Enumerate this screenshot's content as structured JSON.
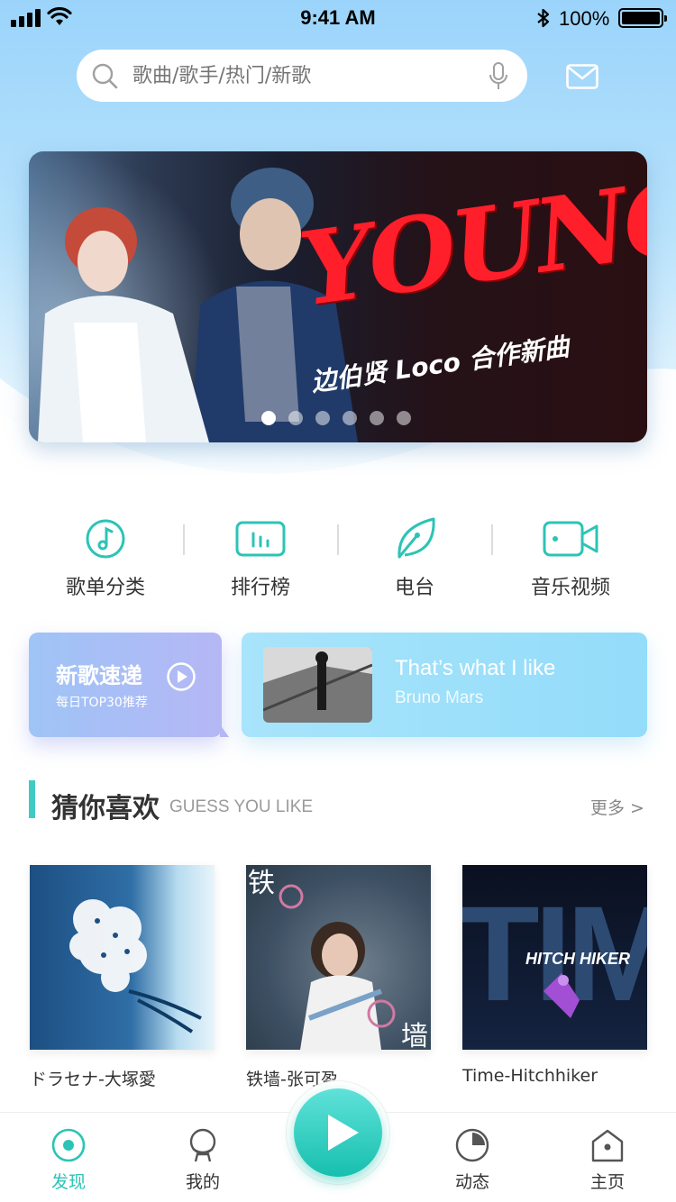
{
  "status_bar": {
    "time": "9:41 AM",
    "battery": "100%"
  },
  "search": {
    "placeholder": "歌曲/歌手/热门/新歌",
    "value": ""
  },
  "banner": {
    "title": "YOUNG",
    "subtitle": "边伯贤 Loco 合作新曲",
    "slide_count": 6,
    "active_slide": 1
  },
  "categories": [
    {
      "label": "歌单分类",
      "icon": "music-note-icon"
    },
    {
      "label": "排行榜",
      "icon": "chart-bars-icon"
    },
    {
      "label": "电台",
      "icon": "leaf-radio-icon"
    },
    {
      "label": "音乐视频",
      "icon": "video-camera-icon"
    }
  ],
  "new_songs": {
    "title": "新歌速递",
    "subtitle": "每日TOP30推荐"
  },
  "now_song": {
    "title": "That’s what I like",
    "artist": "Bruno Mars"
  },
  "section": {
    "title": "猜你喜欢",
    "subtitle": "GUESS YOU LIKE",
    "more": "更多 >"
  },
  "albums": [
    {
      "name": "ドラセナ-大塚愛"
    },
    {
      "name": "铁墙-张可盈",
      "cover_text_1": "铁",
      "cover_text_2": "墙"
    },
    {
      "name": "Time-Hitchhiker",
      "cover_text": "TIME",
      "cover_logo": "HITCH HIKER"
    }
  ],
  "tabs": [
    {
      "label": "发现",
      "icon": "discover-icon",
      "active": true
    },
    {
      "label": "我的",
      "icon": "profile-icon",
      "active": false
    },
    {
      "label": "动态",
      "icon": "pie-chart-icon",
      "active": false
    },
    {
      "label": "主页",
      "icon": "home-icon",
      "active": false
    }
  ],
  "colors": {
    "accent": "#2cc4b6",
    "banner_title": "#ff1f2a"
  }
}
